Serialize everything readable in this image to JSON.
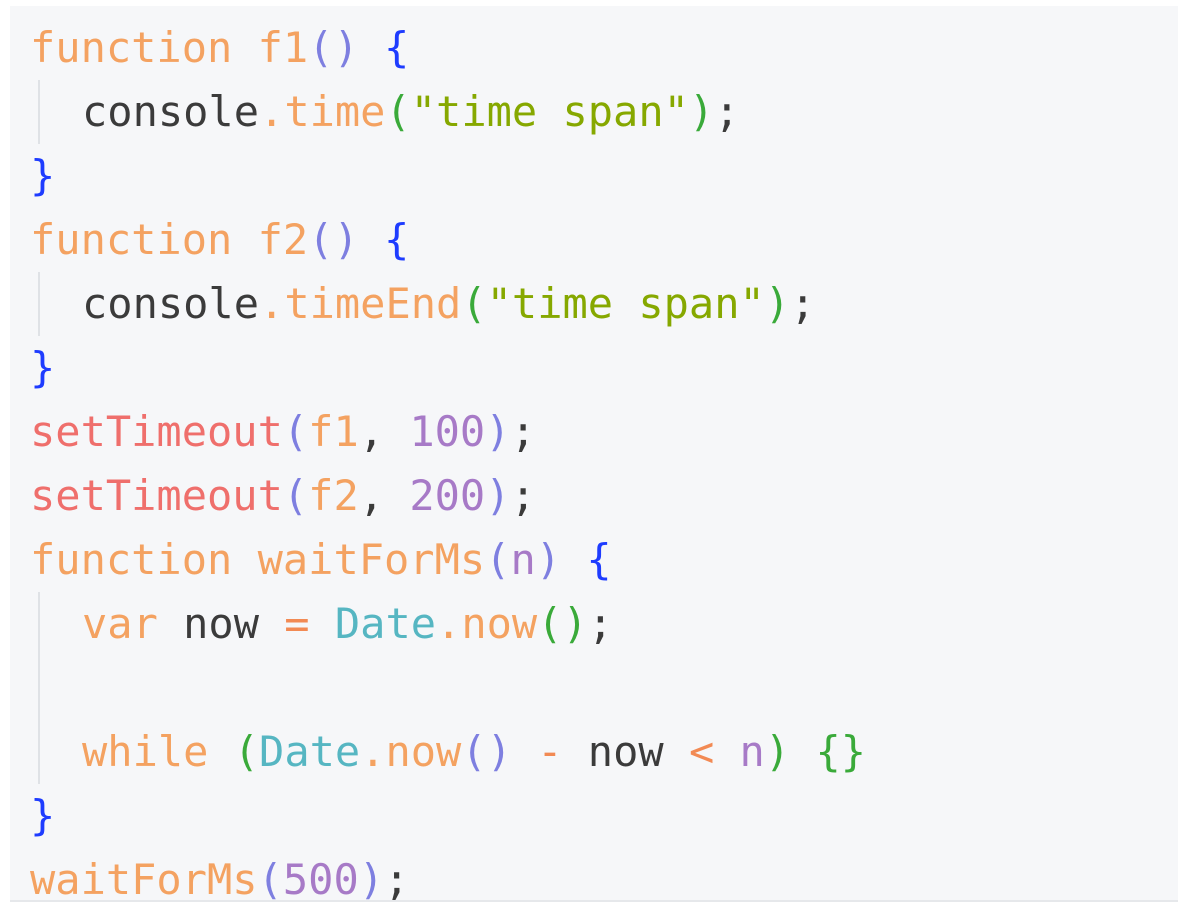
{
  "code_lines": [
    {
      "indent": false,
      "tokens": [
        {
          "t": "function",
          "c": "kw"
        },
        {
          "t": " ",
          "c": "ident"
        },
        {
          "t": "f1",
          "c": "fn"
        },
        {
          "t": "()",
          "c": "paren"
        },
        {
          "t": " ",
          "c": "ident"
        },
        {
          "t": "{",
          "c": "punc1"
        }
      ]
    },
    {
      "indent": true,
      "tokens": [
        {
          "t": "console",
          "c": "ident"
        },
        {
          "t": ".",
          "c": "prop"
        },
        {
          "t": "time",
          "c": "prop"
        },
        {
          "t": "(",
          "c": "paren2"
        },
        {
          "t": "\"time span\"",
          "c": "str"
        },
        {
          "t": ")",
          "c": "paren2"
        },
        {
          "t": ";",
          "c": "semi"
        }
      ]
    },
    {
      "indent": false,
      "tokens": [
        {
          "t": "}",
          "c": "punc1"
        }
      ]
    },
    {
      "indent": false,
      "tokens": [
        {
          "t": "function",
          "c": "kw"
        },
        {
          "t": " ",
          "c": "ident"
        },
        {
          "t": "f2",
          "c": "fn"
        },
        {
          "t": "()",
          "c": "paren"
        },
        {
          "t": " ",
          "c": "ident"
        },
        {
          "t": "{",
          "c": "punc1"
        }
      ]
    },
    {
      "indent": true,
      "tokens": [
        {
          "t": "console",
          "c": "ident"
        },
        {
          "t": ".",
          "c": "prop"
        },
        {
          "t": "timeEnd",
          "c": "prop"
        },
        {
          "t": "(",
          "c": "paren2"
        },
        {
          "t": "\"time span\"",
          "c": "str"
        },
        {
          "t": ")",
          "c": "paren2"
        },
        {
          "t": ";",
          "c": "semi"
        }
      ]
    },
    {
      "indent": false,
      "tokens": [
        {
          "t": "}",
          "c": "punc1"
        }
      ]
    },
    {
      "indent": false,
      "tokens": [
        {
          "t": "setTimeout",
          "c": "call"
        },
        {
          "t": "(",
          "c": "paren"
        },
        {
          "t": "f1",
          "c": "fn"
        },
        {
          "t": ", ",
          "c": "semi"
        },
        {
          "t": "100",
          "c": "num"
        },
        {
          "t": ")",
          "c": "paren"
        },
        {
          "t": ";",
          "c": "semi"
        }
      ]
    },
    {
      "indent": false,
      "tokens": [
        {
          "t": "setTimeout",
          "c": "call"
        },
        {
          "t": "(",
          "c": "paren"
        },
        {
          "t": "f2",
          "c": "fn"
        },
        {
          "t": ", ",
          "c": "semi"
        },
        {
          "t": "200",
          "c": "num"
        },
        {
          "t": ")",
          "c": "paren"
        },
        {
          "t": ";",
          "c": "semi"
        }
      ]
    },
    {
      "indent": false,
      "tokens": [
        {
          "t": "function",
          "c": "kw"
        },
        {
          "t": " ",
          "c": "ident"
        },
        {
          "t": "waitForMs",
          "c": "fn"
        },
        {
          "t": "(",
          "c": "paren"
        },
        {
          "t": "n",
          "c": "param"
        },
        {
          "t": ")",
          "c": "paren"
        },
        {
          "t": " ",
          "c": "ident"
        },
        {
          "t": "{",
          "c": "punc1"
        }
      ]
    },
    {
      "indent": true,
      "tokens": [
        {
          "t": "var",
          "c": "kw"
        },
        {
          "t": " now ",
          "c": "ident"
        },
        {
          "t": "=",
          "c": "op"
        },
        {
          "t": " ",
          "c": "ident"
        },
        {
          "t": "Date",
          "c": "obj"
        },
        {
          "t": ".",
          "c": "prop"
        },
        {
          "t": "now",
          "c": "prop"
        },
        {
          "t": "()",
          "c": "paren2"
        },
        {
          "t": ";",
          "c": "semi"
        }
      ]
    },
    {
      "indent": true,
      "tokens": []
    },
    {
      "indent": true,
      "tokens": [
        {
          "t": "while",
          "c": "kw"
        },
        {
          "t": " ",
          "c": "ident"
        },
        {
          "t": "(",
          "c": "paren2"
        },
        {
          "t": "Date",
          "c": "obj"
        },
        {
          "t": ".",
          "c": "prop"
        },
        {
          "t": "now",
          "c": "prop"
        },
        {
          "t": "()",
          "c": "paren"
        },
        {
          "t": " ",
          "c": "ident"
        },
        {
          "t": "-",
          "c": "op"
        },
        {
          "t": " now ",
          "c": "ident"
        },
        {
          "t": "<",
          "c": "op"
        },
        {
          "t": " ",
          "c": "ident"
        },
        {
          "t": "n",
          "c": "param"
        },
        {
          "t": ")",
          "c": "paren2"
        },
        {
          "t": " ",
          "c": "ident"
        },
        {
          "t": "{}",
          "c": "paren2"
        }
      ]
    },
    {
      "indent": false,
      "tokens": [
        {
          "t": "}",
          "c": "punc1"
        }
      ]
    },
    {
      "indent": false,
      "tokens": [
        {
          "t": "waitForMs",
          "c": "fn"
        },
        {
          "t": "(",
          "c": "paren"
        },
        {
          "t": "500",
          "c": "num"
        },
        {
          "t": ")",
          "c": "paren"
        },
        {
          "t": ";",
          "c": "semi"
        }
      ]
    }
  ],
  "colors": {
    "background": "#f6f7f9",
    "keyword": "#f4a261",
    "string": "#86a800",
    "number": "#a77ac7",
    "call": "#ef6f6c",
    "object": "#56b6c2",
    "brace": "#1e3cff"
  }
}
